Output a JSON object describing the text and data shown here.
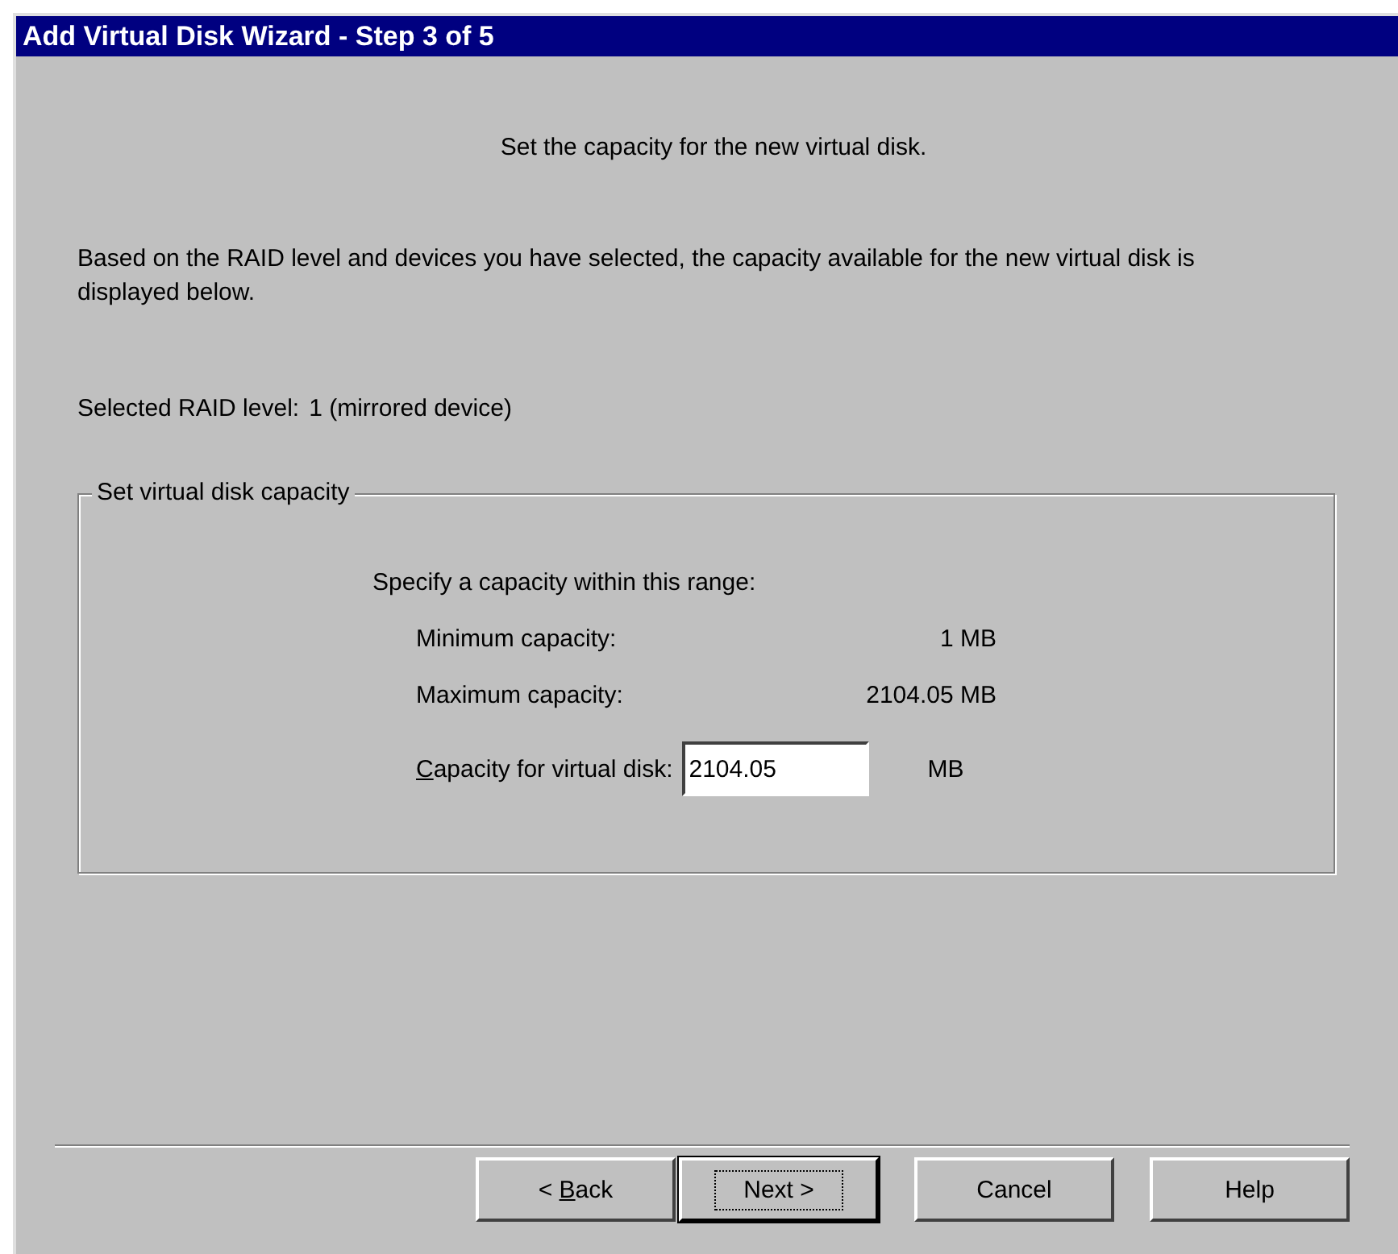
{
  "window": {
    "title": "Add Virtual Disk Wizard - Step 3 of 5"
  },
  "heading": "Set the capacity for the new virtual disk.",
  "description": "Based on the RAID level and devices you have selected, the capacity available for the new virtual disk is displayed below.",
  "raid": {
    "label": "Selected RAID level:",
    "value": "1 (mirrored device)"
  },
  "group": {
    "title": "Set virtual disk capacity",
    "instruction": "Specify a capacity within this range:",
    "ranges": [
      {
        "label": "Minimum capacity:",
        "value": "1 MB"
      },
      {
        "label": "Maximum capacity:",
        "value": "2104.05 MB"
      }
    ],
    "field": {
      "mnemonic": "C",
      "label_rest": "apacity for virtual disk:",
      "value": "2104.05",
      "unit": "MB"
    }
  },
  "buttons": [
    {
      "prefix": "< ",
      "mnemonic": "B",
      "label": "ack",
      "default": false
    },
    {
      "label": "Next >",
      "default": true
    },
    {
      "label": "Cancel",
      "default": false
    },
    {
      "label": "Help",
      "default": false
    }
  ]
}
